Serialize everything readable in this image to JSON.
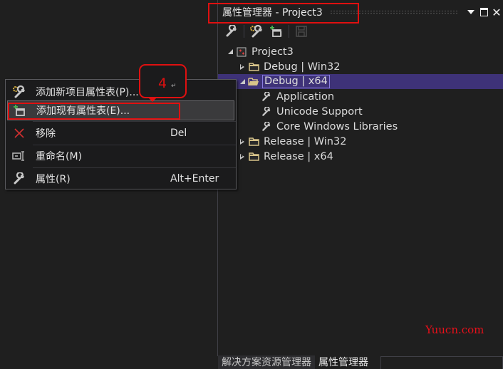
{
  "panel": {
    "title": "属性管理器 - Project3",
    "window_buttons": {
      "dropdown": "dropdown-icon",
      "maximize": "maximize-icon",
      "close": "close-icon"
    }
  },
  "toolbar": {
    "buttons": [
      {
        "name": "properties",
        "icon": "wrench-icon"
      },
      {
        "name": "add-new-property-sheet",
        "icon": "gear-wrench-icon"
      },
      {
        "name": "add-existing-property-sheet",
        "icon": "add-sheet-icon"
      },
      {
        "name": "save",
        "icon": "save-icon",
        "disabled": true
      }
    ]
  },
  "tree": {
    "nodes": [
      {
        "label": "Project3",
        "level": 0,
        "state": "expanded",
        "icon": "project-icon"
      },
      {
        "label": "Debug | Win32",
        "level": 1,
        "state": "collapsed",
        "icon": "folder-icon"
      },
      {
        "label": "Debug | x64",
        "level": 1,
        "state": "expanded",
        "icon": "folder-open-icon",
        "selected": true
      },
      {
        "label": "Application",
        "level": 2,
        "icon": "wrench-icon"
      },
      {
        "label": "Unicode Support",
        "level": 2,
        "icon": "wrench-icon"
      },
      {
        "label": "Core Windows Libraries",
        "level": 2,
        "icon": "wrench-icon"
      },
      {
        "label": "Release | Win32",
        "level": 1,
        "state": "collapsed",
        "icon": "folder-icon"
      },
      {
        "label": "Release | x64",
        "level": 1,
        "state": "collapsed",
        "icon": "folder-icon"
      }
    ]
  },
  "context_menu": {
    "items": [
      {
        "label": "添加新项目属性表(P)...",
        "shortcut": "",
        "icon": "gear-wrench-icon"
      },
      {
        "label": "添加现有属性表(E)...",
        "shortcut": "",
        "icon": "add-sheet-icon",
        "hovered": true
      },
      {
        "label": "移除",
        "shortcut": "Del",
        "icon": "remove-x-icon"
      },
      {
        "label": "重命名(M)",
        "shortcut": "",
        "icon": "rename-icon"
      },
      {
        "label": "属性(R)",
        "shortcut": "Alt+Enter",
        "icon": "wrench-icon"
      }
    ]
  },
  "annotation": {
    "step_number": "4",
    "return_mark": "↵",
    "color": "#e01010"
  },
  "bottom_tabs": [
    {
      "label": "解决方案资源管理器",
      "active": false
    },
    {
      "label": "属性管理器",
      "active": true
    }
  ],
  "watermark": "Yuucn.com",
  "colors": {
    "background": "#1f1f1f",
    "selection": "#3e3278",
    "highlight_red": "#e01010",
    "folder": "#d8c48a"
  }
}
